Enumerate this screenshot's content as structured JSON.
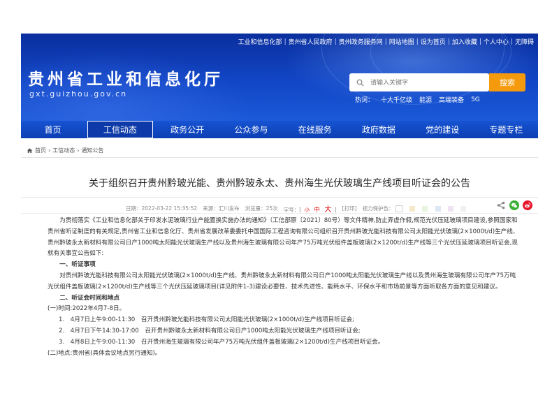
{
  "top_links": [
    "工业和信息化部",
    "贵州省人民政府",
    "贵州政务服务网",
    "网站地图",
    "设为首页",
    "加入收藏",
    "个人中心",
    "无障碍"
  ],
  "site": {
    "title": "贵州省工业和信息化厅",
    "url": "gxt.guizhou.gov.cn"
  },
  "search": {
    "placeholder": "请输入关键字",
    "button": "搜索",
    "hot_label": "热词：",
    "hot_words": [
      "十大千亿级",
      "能源",
      "高端装备",
      "5G"
    ]
  },
  "nav": {
    "items": [
      "首页",
      "工信动态",
      "政务公开",
      "公众参与",
      "在线服务",
      "政府数据",
      "党的建设",
      "专题专栏"
    ],
    "active_index": 1
  },
  "breadcrumb": {
    "items": [
      "首页",
      "工信动态",
      "通知公告"
    ],
    "separator": "›"
  },
  "article": {
    "title": "关于组织召开贵州黔玻光能、贵州黔玻永太、贵州海生光伏玻璃生产线项目听证会的公告",
    "meta": {
      "date": "日期：2022-03-22 15:35:52",
      "source": "来源：汇川发布",
      "views_label": "浏览量：",
      "views": "25次",
      "font_label": "字号：[",
      "font_small": "小",
      "font_mid": "中",
      "font_big": "大",
      "font_end": "]",
      "print": "[打印]",
      "vision_label": "视力保护色：",
      "colors": [
        "#ffffff",
        "#f5e9c9",
        "#e8f4e0",
        "#dde8f5",
        "#efe3f3",
        "#f0f0f0"
      ]
    },
    "paragraphs": [
      {
        "type": "ind",
        "text": "为贯彻落实《工业和信息化部关于印发水泥玻璃行业产能置换实施办法的通知》（工信部原〔2021〕80号）等文件精神,防止弄虚作假,规范光伏压延玻璃项目建设,参照国家和贵州省听证制度的有关规定,贵州省工业和信息化厅、贵州省发展改革委委托中国国际工程咨询有限公司组织召开贵州黔玻光能科技有限公司太阳能光伏玻璃(2×1000t/d)生产线、贵州黔玻永太新材料有限公司日产1000吨太阳能光伏玻璃生产线以及贵州海生玻璃有限公司年产75万吨光伏组件盖板玻璃(2×1200t/d)生产线等三个光伏压延玻璃项目听证会,现就有关事宜公告如下:"
      },
      {
        "type": "h",
        "text": "一、听证事项"
      },
      {
        "type": "ind",
        "text": "对贵州黔玻光能科技有限公司太阳能光伏玻璃(2×1000t/d)生产线、贵州黔玻永太新材料有限公司日产1000吨太阳能光伏玻璃生产线以及贵州海生玻璃有限公司年产75万吨光伏组件盖板玻璃(2×1200t/d)生产线等三个光伏压延玻璃项目(详见附件1-3)建设必要性、技术先进性、能耗水平、环保水平和市场前景等方面听取各方面的意见和建议。"
      },
      {
        "type": "h",
        "text": "二、听证会时间和地点"
      },
      {
        "type": "plain",
        "text": "(一)时间:2022年4月7-8日。"
      },
      {
        "type": "li",
        "text": "1.　4月7日上午9:00-11:30　召开贵州黔玻光能科技有限公司太阳能光伏玻璃(2×1000t/d)生产线项目听证会;"
      },
      {
        "type": "li",
        "text": "2.　4月7日下午14:30-17:00　召开贵州黔玻永太新材料有限公司日产1000吨太阳能光伏玻璃生产线项目听证会;"
      },
      {
        "type": "li",
        "text": "3.　4月8日上午9:00-11:30　召开贵州海生玻璃有限公司年产75万吨光伏组件盖板玻璃(2×1200t/d)生产线项目听证会。"
      },
      {
        "type": "plain",
        "text": "(二)地点:贵州省(具体会议地点另行通知)。"
      }
    ]
  },
  "colors": {
    "banner": "#0f3fb8",
    "nav": "#1250cc",
    "search_button": "#f59a0c",
    "wechat": "#3cb034",
    "weibo": "#e6162d",
    "share": "#888888"
  }
}
